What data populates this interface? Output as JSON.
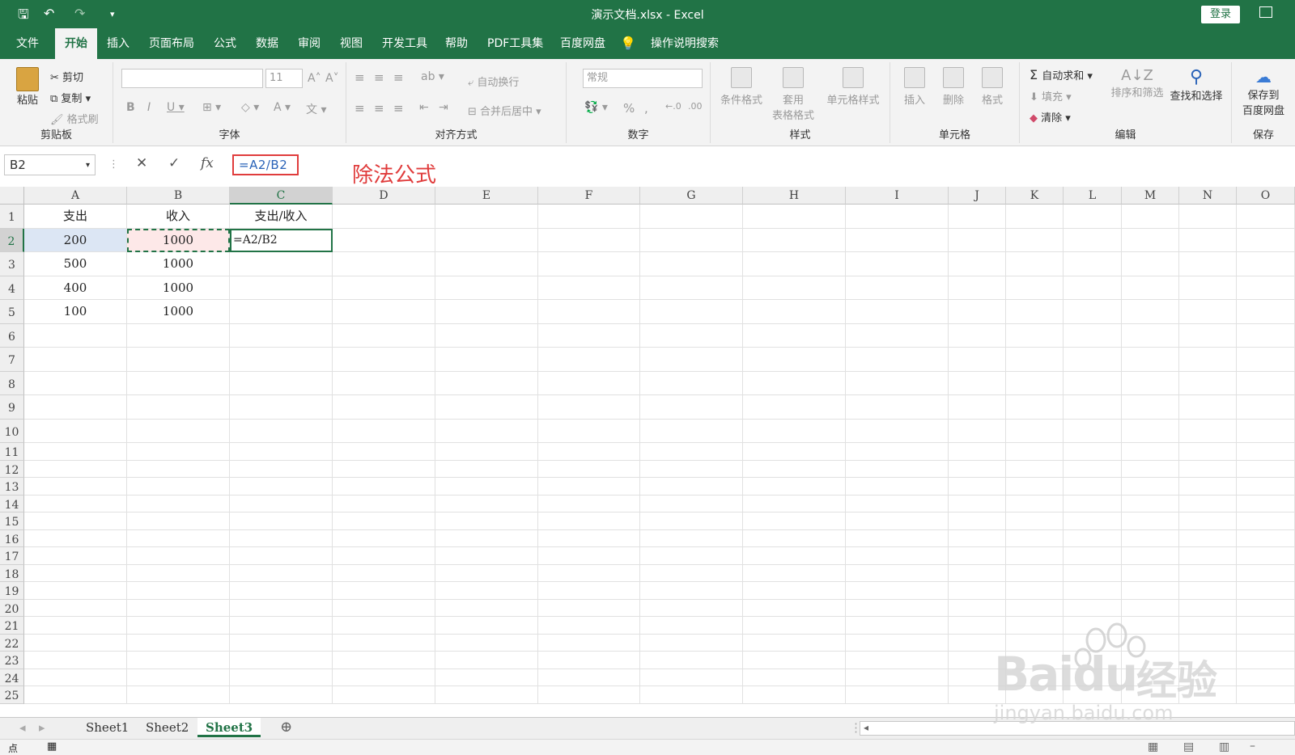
{
  "window": {
    "title": "演示文档.xlsx - Excel",
    "login_label": "登录"
  },
  "ribbon_tabs": [
    "文件",
    "开始",
    "插入",
    "页面布局",
    "公式",
    "数据",
    "审阅",
    "视图",
    "开发工具",
    "帮助",
    "PDF工具集",
    "百度网盘",
    "操作说明搜索"
  ],
  "ribbon": {
    "clipboard": {
      "paste": "粘贴",
      "cut": "剪切",
      "copy": "复制",
      "format_painter": "格式刷",
      "label": "剪贴板"
    },
    "font": {
      "font_size": "11",
      "label": "字体"
    },
    "alignment": {
      "wrap": "自动换行",
      "merge": "合并后居中",
      "label": "对齐方式"
    },
    "number": {
      "format": "常规",
      "label": "数字"
    },
    "styles": {
      "conditional": "条件格式",
      "table_line1": "套用",
      "table_line2": "表格格式",
      "cell_styles": "单元格样式",
      "label": "样式"
    },
    "cells": {
      "insert": "插入",
      "delete": "删除",
      "format": "格式",
      "label": "单元格"
    },
    "editing": {
      "autosum": "自动求和",
      "fill": "填充",
      "clear": "清除",
      "sort": "排序和筛选",
      "find": "查找和选择",
      "label": "编辑"
    },
    "save": {
      "line1": "保存到",
      "line2": "百度网盘",
      "label": "保存"
    }
  },
  "formula_bar": {
    "name_box": "B2",
    "formula": "=A2/B2",
    "annotation": "除法公式"
  },
  "columns": [
    "A",
    "B",
    "C",
    "D",
    "E",
    "F",
    "G",
    "H",
    "I",
    "J",
    "K",
    "L",
    "M",
    "N",
    "O"
  ],
  "rows": [
    "1",
    "2",
    "3",
    "4",
    "5",
    "6",
    "7",
    "8",
    "9",
    "10",
    "11",
    "12",
    "13",
    "14",
    "15",
    "16",
    "17",
    "18",
    "19",
    "20",
    "21",
    "22",
    "23",
    "24",
    "25"
  ],
  "cells": {
    "A1": "支出",
    "B1": "收入",
    "C1": "支出/收入",
    "A2": "200",
    "B2": "1000",
    "C2": "=A2/B2",
    "A3": "500",
    "B3": "1000",
    "A4": "400",
    "B4": "1000",
    "A5": "100",
    "B5": "1000"
  },
  "sheets": [
    "Sheet1",
    "Sheet2",
    "Sheet3"
  ],
  "active_sheet": "Sheet3",
  "status": {
    "mode": "点"
  },
  "watermark": {
    "brand": "Baidu",
    "cn": "经验",
    "url": "jingyan.baidu.com"
  },
  "colors": {
    "excel_green": "#217346",
    "annotation_red": "#e03c3c",
    "copy_fill": "#fde8e8",
    "active_fill": "#dce6f4"
  }
}
